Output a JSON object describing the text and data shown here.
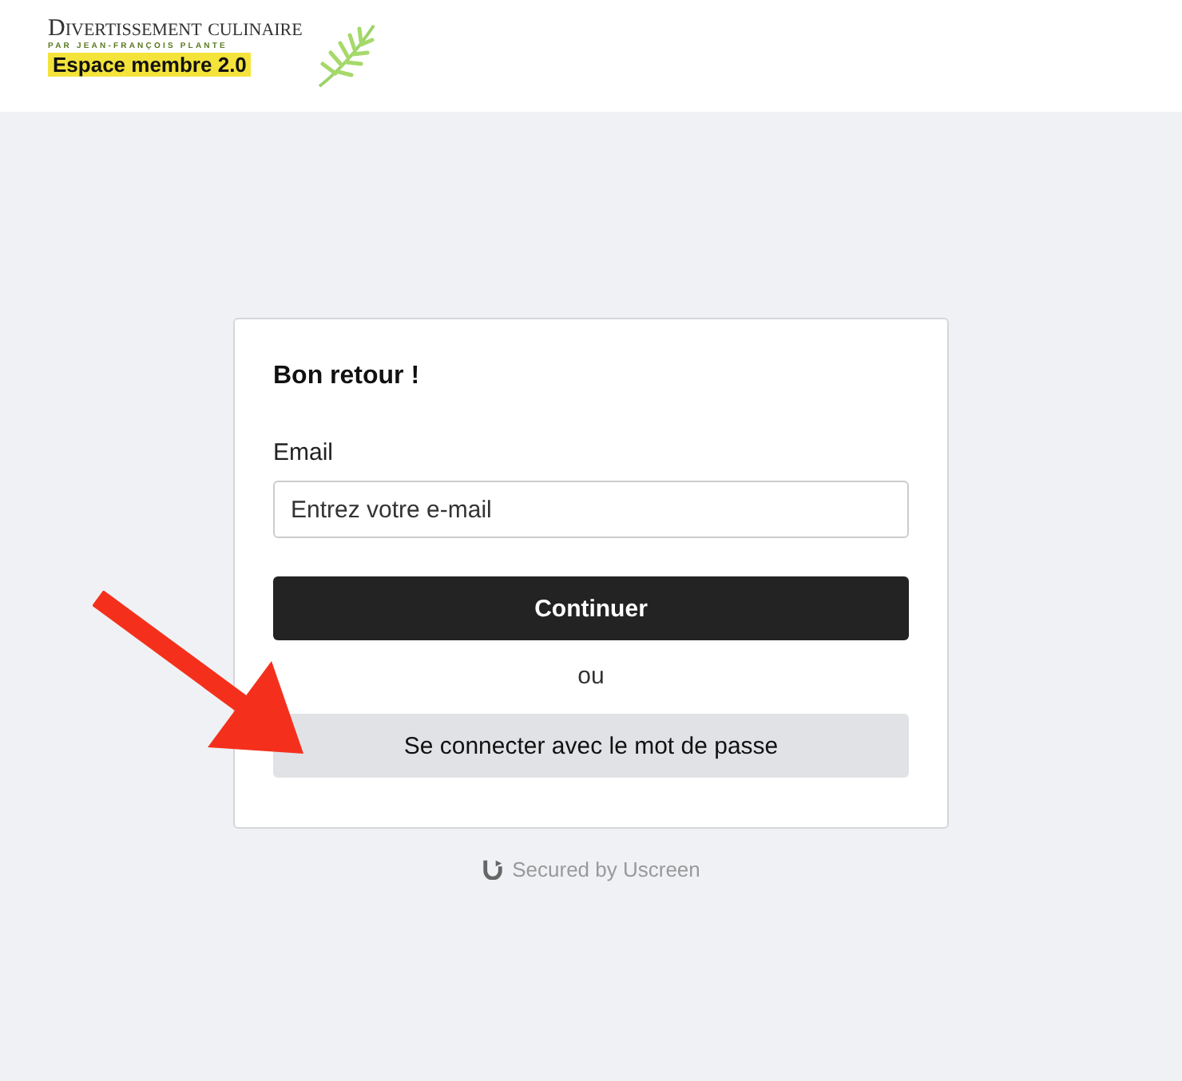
{
  "header": {
    "logo": {
      "title": "Divertissement culinaire",
      "subtitle": "PAR JEAN-FRANÇOIS PLANTE",
      "tagline": "Espace membre 2.0"
    }
  },
  "card": {
    "heading": "Bon retour !",
    "email_label": "Email",
    "email_field": {
      "placeholder": "Entrez votre e-mail"
    },
    "primary_button": "Continuer",
    "separator": "ou",
    "secondary_button": "Se connecter avec le mot de passe"
  },
  "footer": {
    "text": "Secured by Uscreen"
  }
}
